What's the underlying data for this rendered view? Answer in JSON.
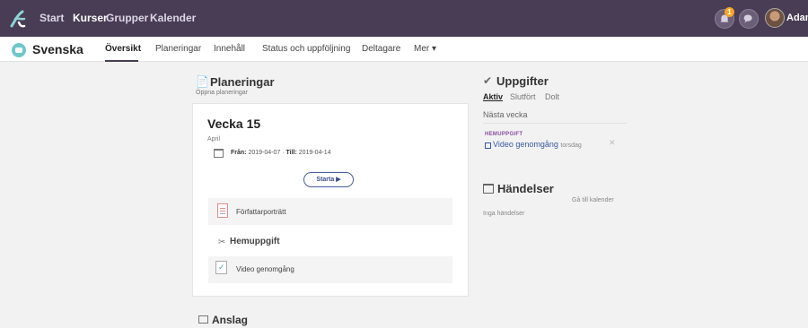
{
  "topbar": {
    "nav": [
      "Start",
      "Kurser",
      "Grupper",
      "Kalender"
    ],
    "notifications_count": "1",
    "user_name": "Adam",
    "background_color": "#483d55"
  },
  "subbar": {
    "course_title": "Svenska",
    "tabs": [
      "Översikt",
      "Planeringar",
      "Innehåll",
      "Status och uppföljning",
      "Deltagare",
      "Mer ▾"
    ]
  },
  "planeringar": {
    "title": "Planeringar",
    "subtitle": "Öppna planeringar",
    "card": {
      "week_title": "Vecka 15",
      "month": "April",
      "from_label": "Från:",
      "from_date": "2019-04-07",
      "to_label": "Till:",
      "to_date": "2019-04-14",
      "start_button": "Starta ▶",
      "item_author": "Författarporträtt",
      "homework_title": "Hemuppgift",
      "item_video": "Video genomgång"
    }
  },
  "anslag": {
    "title": "Anslag"
  },
  "uppgifter": {
    "title": "Uppgifter",
    "filters": [
      "Aktiv",
      "Slutfört",
      "Dolt"
    ],
    "next_week": "Nästa vecka",
    "task_type": "HEMUPPGIFT",
    "task_name": "Video genomgång",
    "task_day": "torsdag"
  },
  "handelser": {
    "title": "Händelser",
    "calendar_link": "Gå till kalender",
    "empty_text": "Inga händelser"
  }
}
